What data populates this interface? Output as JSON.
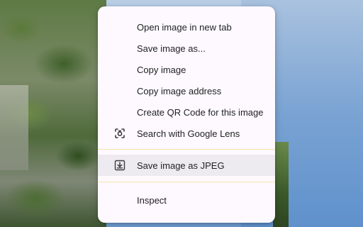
{
  "menu": {
    "items": [
      {
        "label": "Open image in new tab"
      },
      {
        "label": "Save image as..."
      },
      {
        "label": "Copy image"
      },
      {
        "label": "Copy image address"
      },
      {
        "label": "Create QR Code for this image"
      },
      {
        "label": "Search with Google Lens",
        "icon": "google-lens-icon"
      }
    ],
    "extension_items": [
      {
        "label": "Save image as JPEG",
        "icon": "download-icon"
      }
    ],
    "inspect": {
      "label": "Inspect"
    }
  },
  "colors": {
    "menu_bg": "#fdf9ff",
    "highlight": "#eeebf0",
    "separator": "#f1e4a8",
    "text": "#1f1f1f"
  }
}
